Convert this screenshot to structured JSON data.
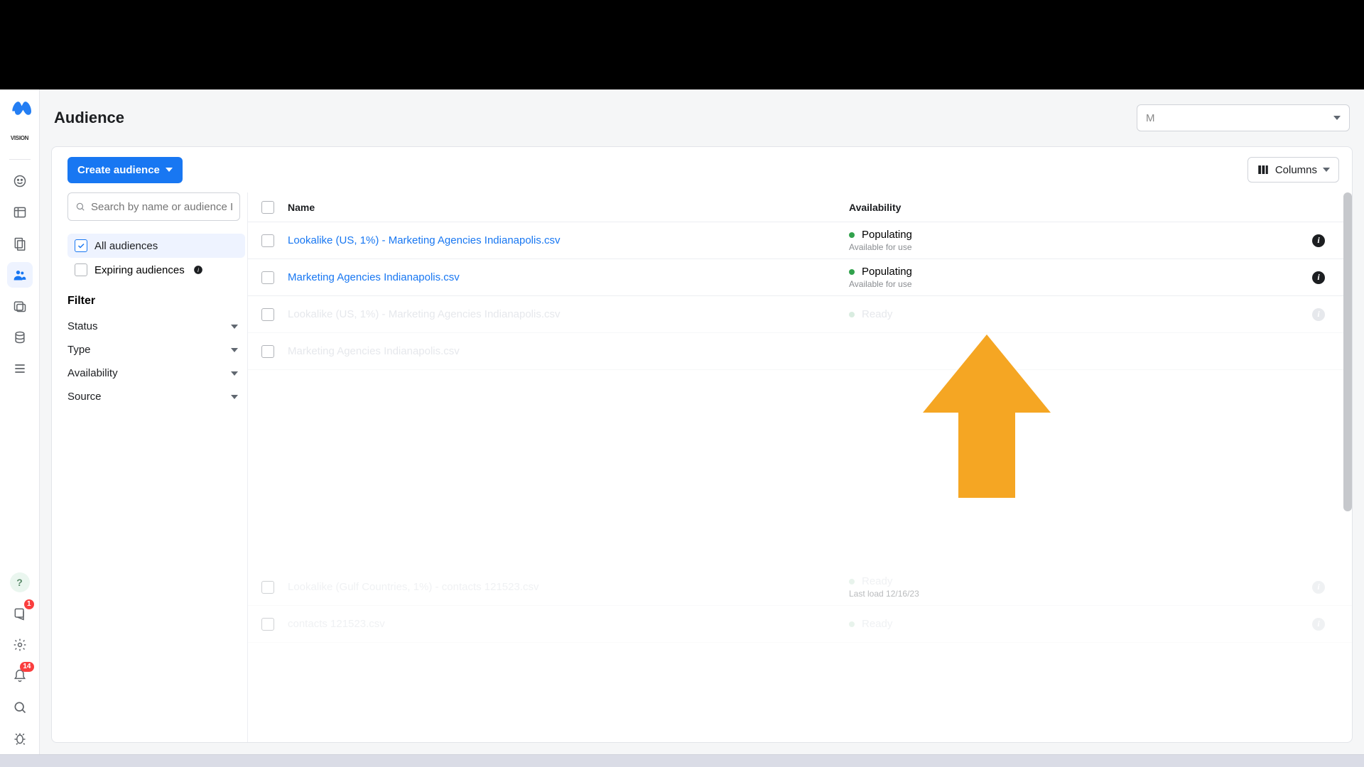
{
  "page": {
    "title": "Audience"
  },
  "account_dropdown": {
    "text": "M"
  },
  "toolbar": {
    "create_label": "Create audience",
    "columns_label": "Columns"
  },
  "search": {
    "placeholder": "Search by name or audience ID"
  },
  "audience_sets": {
    "all_label": "All audiences",
    "expiring_label": "Expiring audiences"
  },
  "filter": {
    "heading": "Filter",
    "items": [
      "Status",
      "Type",
      "Availability",
      "Source"
    ]
  },
  "table": {
    "headers": {
      "name": "Name",
      "availability": "Availability"
    }
  },
  "rows": [
    {
      "name": "Lookalike (US, 1%) - Marketing Agencies Indianapolis.csv",
      "status": "Populating",
      "substatus": "Available for use",
      "faded": false
    },
    {
      "name": "Marketing Agencies Indianapolis.csv",
      "status": "Populating",
      "substatus": "Available for use",
      "faded": false
    },
    {
      "name": "Lookalike (US, 1%) - Marketing Agencies Indianapolis.csv",
      "status": "Ready",
      "substatus": "",
      "faded": true
    },
    {
      "name": "Marketing Agencies Indianapolis.csv",
      "status": "",
      "substatus": "",
      "faded": true
    }
  ],
  "faded_lower": [
    {
      "name": "Lookalike (Gulf Countries, 1%) - contacts 121523.csv",
      "status": "Ready",
      "substatus": "Last load 12/16/23"
    },
    {
      "name": "contacts 121523.csv",
      "status": "Ready",
      "substatus": ""
    }
  ],
  "badges": {
    "settings_help_count": "1",
    "bell_count": "14"
  },
  "brand_small": "VISION"
}
